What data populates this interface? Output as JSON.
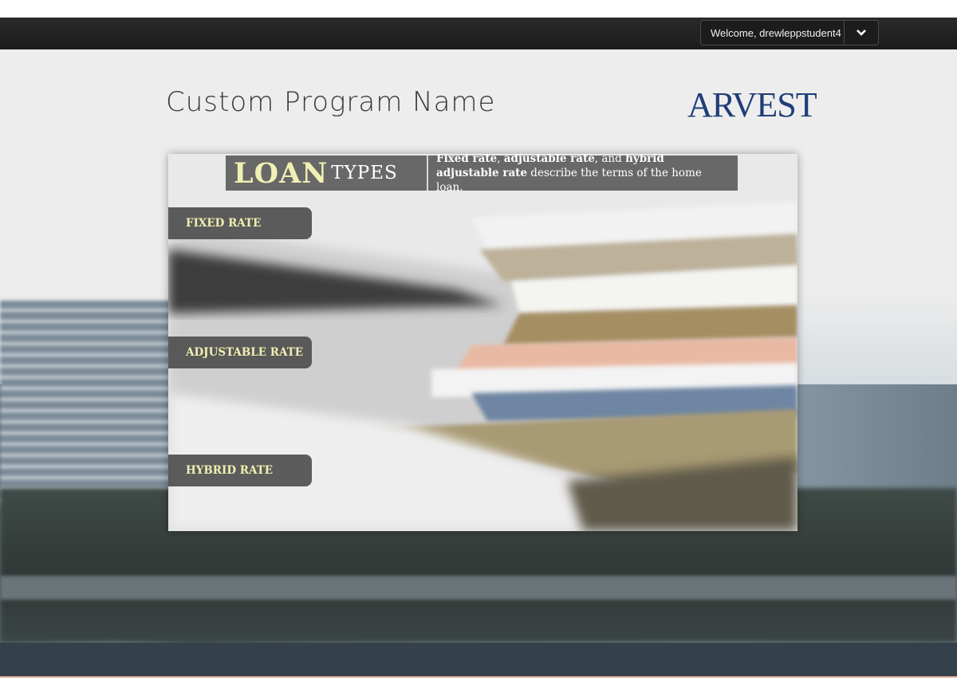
{
  "header": {
    "user_menu": {
      "welcome_text": "Welcome, drewleppstudent4",
      "dropdown_icon": "chevron-down-icon"
    }
  },
  "page": {
    "program_title": "Custom Program Name",
    "logo_text": "ARVEST"
  },
  "slide": {
    "title_word_1": "LOAN",
    "title_word_2": "TYPES",
    "description": {
      "term_1": "Fixed rate",
      "sep_1": ", ",
      "term_2": "adjustable rate",
      "sep_2": ", and ",
      "term_3": "hybrid adjustable rate",
      "rest": " describe the terms of the home loan."
    },
    "tabs": [
      {
        "label": "FIXED RATE"
      },
      {
        "label": "ADJUSTABLE RATE"
      },
      {
        "label": "HYBRID RATE"
      }
    ]
  },
  "colors": {
    "topbar": "#1f1f1f",
    "footer": "#35414a",
    "logo": "#1f3d78",
    "tab_text": "#f0efb2"
  }
}
